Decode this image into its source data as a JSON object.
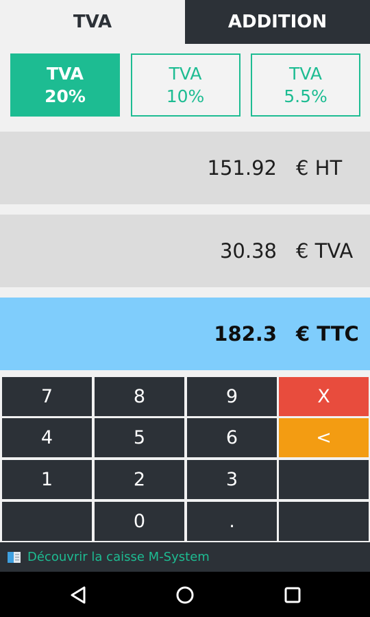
{
  "tabs": {
    "tva": "TVA",
    "addition": "ADDITION"
  },
  "rates": [
    {
      "label": "TVA",
      "value": "20%"
    },
    {
      "label": "TVA",
      "value": "10%"
    },
    {
      "label": "TVA",
      "value": "5.5%"
    }
  ],
  "results": {
    "ht": {
      "value": "151.92",
      "unit": "€ HT"
    },
    "tva": {
      "value": "30.38",
      "unit": "€ TVA"
    },
    "ttc": {
      "value": "182.3",
      "unit": "€ TTC"
    }
  },
  "keypad": {
    "k7": "7",
    "k8": "8",
    "k9": "9",
    "clear": "X",
    "k4": "4",
    "k5": "5",
    "k6": "6",
    "back": "<",
    "k1": "1",
    "k2": "2",
    "k3": "3",
    "k0": "0",
    "dot": "."
  },
  "footer": {
    "text": "Découvrir la caisse M-System"
  },
  "colors": {
    "accent": "#1dbc92",
    "dark": "#2c3137",
    "ttc": "#7fcdfc",
    "clear": "#e84c3d",
    "back": "#f39c12"
  },
  "icons": {
    "footer": "book-icon",
    "nav": [
      "back-triangle-icon",
      "home-circle-icon",
      "recents-square-icon"
    ]
  }
}
